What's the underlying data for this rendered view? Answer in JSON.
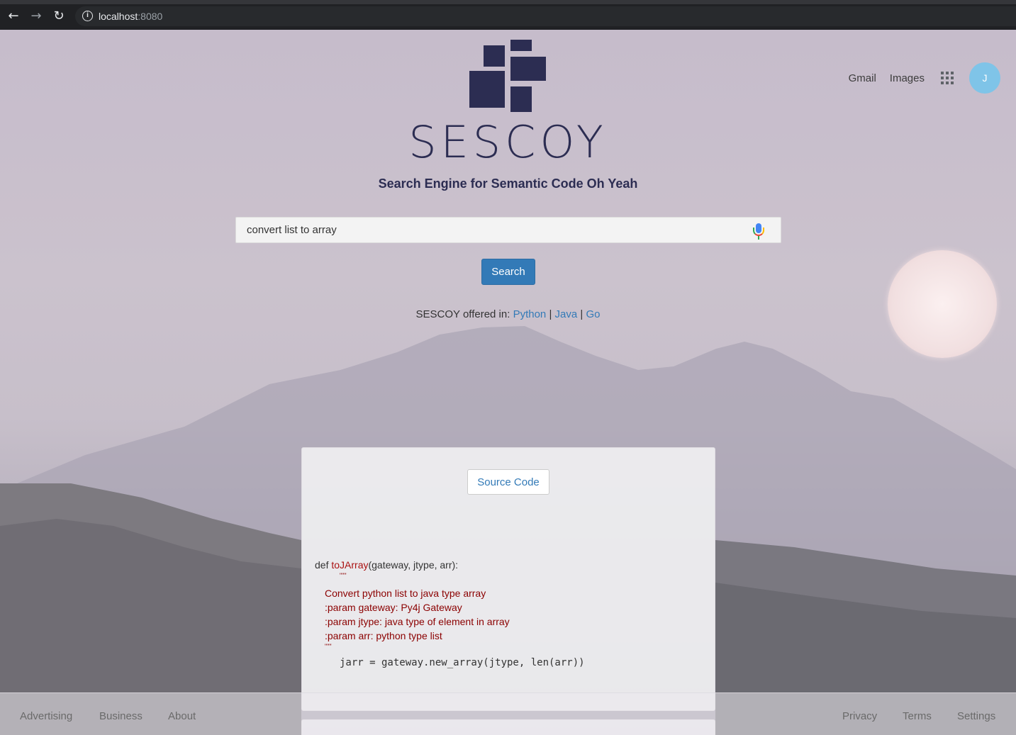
{
  "browser": {
    "url_host": "localhost",
    "url_port": ":8080"
  },
  "header": {
    "gmail": "Gmail",
    "images": "Images",
    "avatar_initial": "J"
  },
  "brand": {
    "name": "SESCOY",
    "tagline": "Search Engine for Semantic Code  Oh Yeah",
    "logo_color": "#2c2d52"
  },
  "search": {
    "value": "convert list to array",
    "button_label": "Search"
  },
  "languages": {
    "prefix": "SESCOY offered in: ",
    "items": [
      "Python",
      "Java",
      "Go"
    ],
    "separator": " | "
  },
  "result": {
    "button_label": "Source Code",
    "code": {
      "def_prefix": "def ",
      "fn_name": "toJArray",
      "signature": "(gateway, jtype, arr):",
      "quote_open": "\"\"\"",
      "doc_lines": [
        "Convert python list to java type array",
        ":param gateway: Py4j Gateway",
        ":param jtype: java type of element in array",
        ":param arr: python type list"
      ],
      "quote_close": "\"\"\"",
      "body_line": "jarr = gateway.new_array(jtype, len(arr))"
    }
  },
  "footer": {
    "left": [
      "Advertising",
      "Business",
      "About"
    ],
    "right": [
      "Privacy",
      "Terms",
      "Settings"
    ]
  },
  "colors": {
    "accent": "#337ab7",
    "chrome": "#202124",
    "avatar": "#7fc4e8"
  }
}
